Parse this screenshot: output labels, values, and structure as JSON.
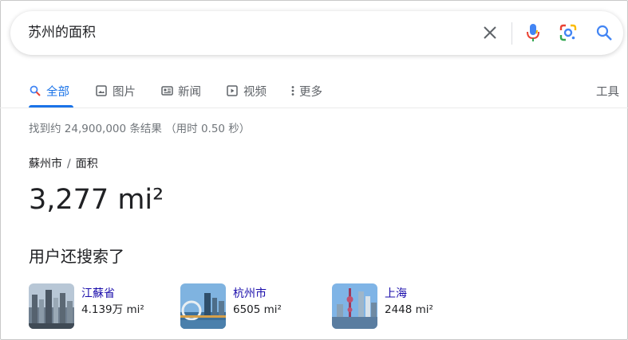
{
  "search": {
    "query": "苏州的面积"
  },
  "tabs": [
    {
      "label": "全部",
      "icon": "search-icon",
      "active": true
    },
    {
      "label": "图片",
      "icon": "image-icon",
      "active": false
    },
    {
      "label": "新闻",
      "icon": "news-icon",
      "active": false
    },
    {
      "label": "视频",
      "icon": "video-icon",
      "active": false
    },
    {
      "label": "更多",
      "icon": "more-vert-icon",
      "active": false
    }
  ],
  "tools_label": "工具",
  "result_stats": "找到约 24,900,000 条结果 （用时 0.50 秒）",
  "answer_box": {
    "breadcrumb": [
      "蘇州市",
      "面积"
    ],
    "breadcrumb_sep": "/",
    "value": "3,277 mi²"
  },
  "people_also_search": {
    "title": "用户还搜索了",
    "items": [
      {
        "name": "江蘇省",
        "value": "4.139万 mi²",
        "thumb": "city-skyline-photo"
      },
      {
        "name": "杭州市",
        "value": "6505 mi²",
        "thumb": "city-bridge-photo"
      },
      {
        "name": "上海",
        "value": "2448 mi²",
        "thumb": "shanghai-tower-photo"
      }
    ]
  },
  "colors": {
    "accent_blue": "#1a73e8",
    "link_blue": "#1a0dab",
    "google_red": "#ea4335",
    "google_yellow": "#fbbc04",
    "google_green": "#34a853"
  }
}
